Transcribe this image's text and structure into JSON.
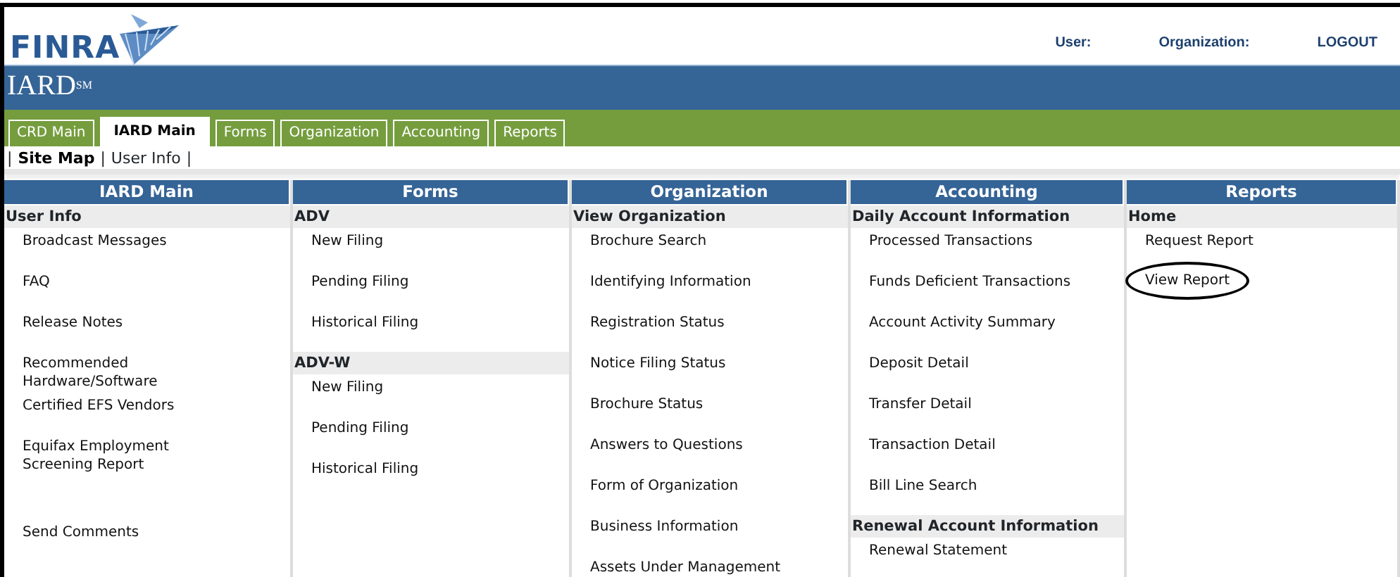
{
  "header": {
    "logo": "FINRA",
    "links": [
      "User:",
      "Organization:",
      "LOGOUT"
    ]
  },
  "banner": {
    "title": "IARD",
    "mark": "SM"
  },
  "tabs": [
    {
      "label": "CRD Main",
      "selected": false
    },
    {
      "label": "IARD Main",
      "selected": true
    },
    {
      "label": "Forms",
      "selected": false
    },
    {
      "label": "Organization",
      "selected": false
    },
    {
      "label": "Accounting",
      "selected": false
    },
    {
      "label": "Reports",
      "selected": false
    }
  ],
  "subnav": {
    "separator": "|",
    "items": [
      {
        "label": "Site Map",
        "selected": true
      },
      {
        "label": "User Info",
        "selected": false
      }
    ]
  },
  "sitemap": [
    {
      "title": "IARD Main",
      "sections": [
        {
          "heading": "User Info",
          "items": [
            {
              "label": "Broadcast Messages",
              "circled": false
            },
            {
              "label": "FAQ",
              "circled": false
            },
            {
              "label": "Release Notes",
              "circled": false
            },
            {
              "label": "Recommended Hardware/Software",
              "circled": false
            },
            {
              "label": "Certified EFS Vendors",
              "circled": false
            },
            {
              "label": "Equifax Employment Screening Report",
              "circled": false
            },
            {
              "label": "Send Comments",
              "circled": false
            }
          ]
        }
      ]
    },
    {
      "title": "Forms",
      "sections": [
        {
          "heading": "ADV",
          "items": [
            {
              "label": "New Filing",
              "circled": false
            },
            {
              "label": "Pending Filing",
              "circled": false
            },
            {
              "label": "Historical Filing",
              "circled": false
            }
          ]
        },
        {
          "heading": "ADV-W",
          "items": [
            {
              "label": "New Filing",
              "circled": false
            },
            {
              "label": "Pending Filing",
              "circled": false
            },
            {
              "label": "Historical Filing",
              "circled": false
            }
          ]
        }
      ]
    },
    {
      "title": "Organization",
      "sections": [
        {
          "heading": "View Organization",
          "items": [
            {
              "label": "Brochure Search",
              "circled": false
            },
            {
              "label": "Identifying Information",
              "circled": false
            },
            {
              "label": "Registration Status",
              "circled": false
            },
            {
              "label": "Notice Filing Status",
              "circled": false
            },
            {
              "label": "Brochure Status",
              "circled": false
            },
            {
              "label": "Answers to Questions",
              "circled": false
            },
            {
              "label": "Form of Organization",
              "circled": false
            },
            {
              "label": "Business Information",
              "circled": false
            },
            {
              "label": "Assets Under Management",
              "circled": false
            }
          ]
        }
      ]
    },
    {
      "title": "Accounting",
      "sections": [
        {
          "heading": "Daily Account Information",
          "items": [
            {
              "label": "Processed Transactions",
              "circled": false
            },
            {
              "label": "Funds Deficient Transactions",
              "circled": false
            },
            {
              "label": "Account Activity Summary",
              "circled": false
            },
            {
              "label": "Deposit Detail",
              "circled": false
            },
            {
              "label": "Transfer Detail",
              "circled": false
            },
            {
              "label": "Transaction Detail",
              "circled": false
            },
            {
              "label": "Bill Line Search",
              "circled": false
            }
          ]
        },
        {
          "heading": "Renewal Account Information",
          "items": [
            {
              "label": "Renewal Statement",
              "circled": false
            }
          ]
        }
      ]
    },
    {
      "title": "Reports",
      "sections": [
        {
          "heading": "Home",
          "items": [
            {
              "label": "Request Report",
              "circled": false
            },
            {
              "label": "View Report",
              "circled": true
            }
          ]
        }
      ]
    }
  ]
}
